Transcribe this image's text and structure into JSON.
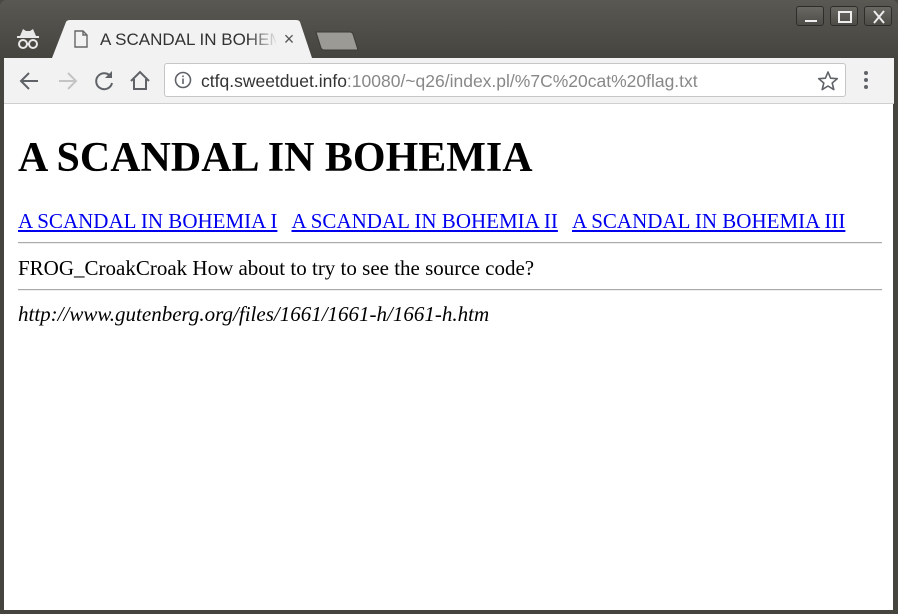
{
  "tab": {
    "title": "A SCANDAL IN BOHEMIA",
    "close": "×"
  },
  "address_bar": {
    "host": "ctfq.sweetduet.info",
    "rest": ":10080/~q26/index.pl/%7C%20cat%20flag.txt"
  },
  "page": {
    "heading": "A SCANDAL IN BOHEMIA",
    "links": [
      "A SCANDAL IN BOHEMIA I",
      "A SCANDAL IN BOHEMIA II",
      "A SCANDAL IN BOHEMIA III"
    ],
    "message": "FROG_CroakCroak How about to try to see the source code?",
    "source": "http://www.gutenberg.org/files/1661/1661-h/1661-h.htm"
  },
  "icons": {
    "incognito": "incognito-icon",
    "back": "back-arrow-icon",
    "forward": "forward-arrow-icon",
    "reload": "reload-icon",
    "home": "home-icon",
    "info": "info-icon",
    "bookmark": "star-icon",
    "menu": "kebab-menu-icon"
  },
  "colors": {
    "link": "#0000ee",
    "frame": "#46443f",
    "toolbar": "#f2f2f2"
  }
}
